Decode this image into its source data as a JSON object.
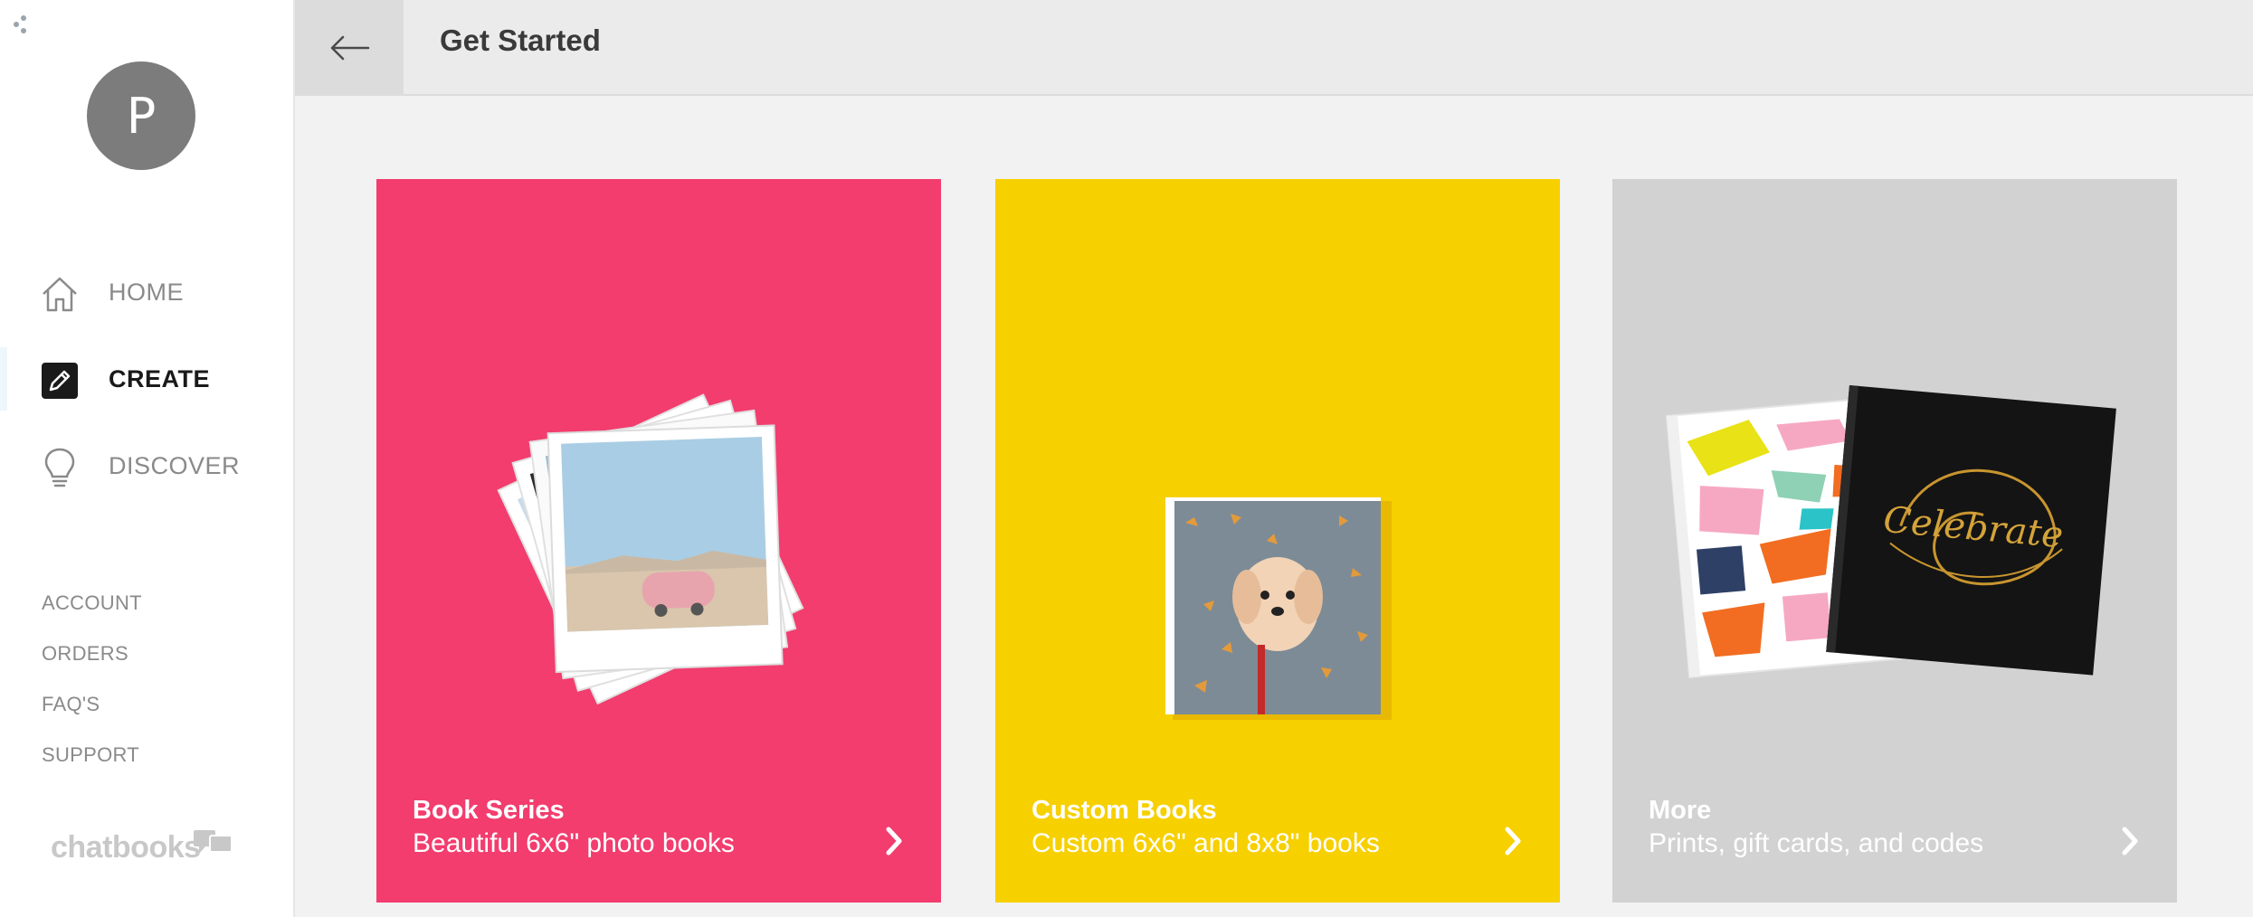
{
  "sidebar": {
    "avatar_initial": "P",
    "nav": [
      {
        "label": "HOME",
        "icon": "home-icon"
      },
      {
        "label": "CREATE",
        "icon": "edit-icon",
        "active": true
      },
      {
        "label": "DISCOVER",
        "icon": "lightbulb-icon"
      }
    ],
    "links": [
      "ACCOUNT",
      "ORDERS",
      "FAQ'S",
      "SUPPORT"
    ],
    "logo_text": "chatbooks"
  },
  "header": {
    "back_icon": "arrow-left-icon",
    "title": "Get Started"
  },
  "cards": [
    {
      "title": "Book Series",
      "subtitle": "Beautiful 6x6\" photo books",
      "color": "#f23d6e"
    },
    {
      "title": "Custom Books",
      "subtitle": "Custom 6x6\" and 8x8\" books",
      "color": "#f7d000"
    },
    {
      "title": "More",
      "subtitle": "Prints, gift cards, and codes",
      "color": "#d2d2d2"
    }
  ],
  "colors": {
    "accent_active": "#1a1a1a",
    "nav_inactive": "#8a8a8a"
  }
}
